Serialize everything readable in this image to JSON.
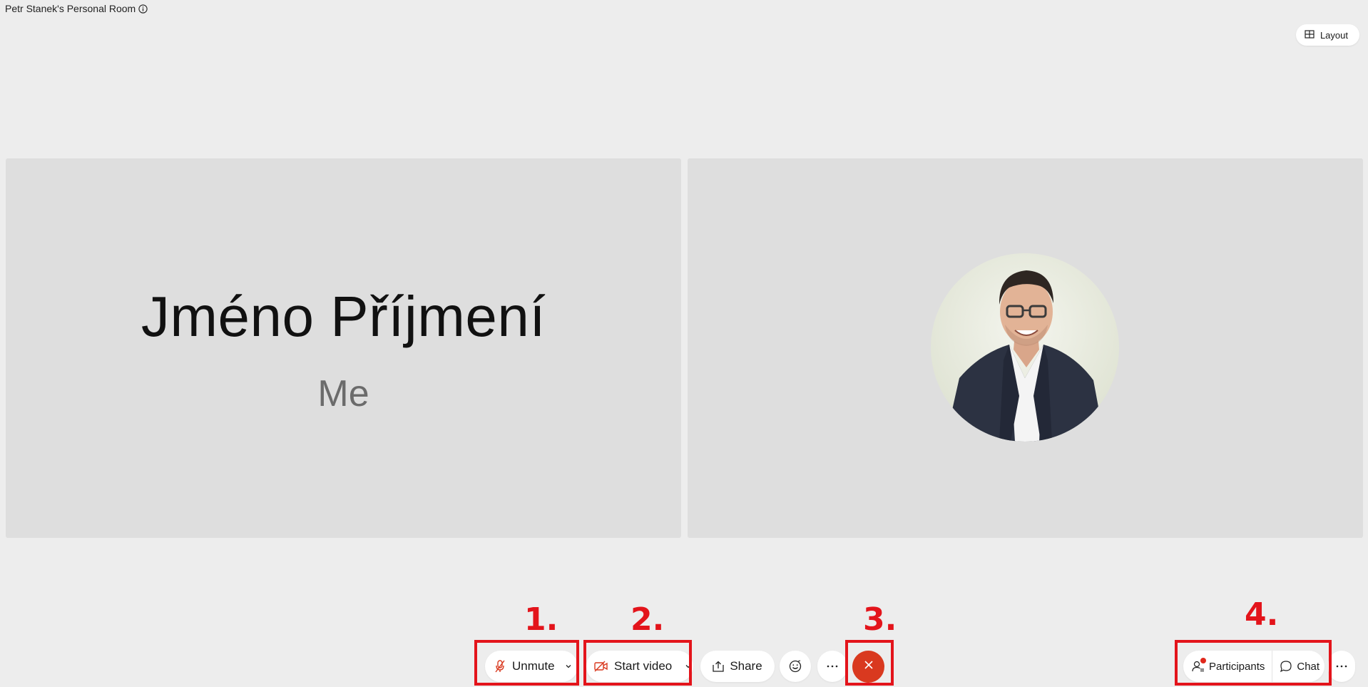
{
  "room": {
    "title": "Petr Stanek's Personal Room"
  },
  "layout": {
    "label": "Layout"
  },
  "tiles": {
    "self": {
      "name": "Jméno Příjmení",
      "subtitle": "Me"
    }
  },
  "toolbar": {
    "unmute_label": "Unmute",
    "start_video_label": "Start video",
    "share_label": "Share"
  },
  "side": {
    "participants_label": "Participants",
    "chat_label": "Chat"
  },
  "annotations": {
    "one": "1.",
    "two": "2.",
    "three": "3.",
    "four": "4."
  },
  "colors": {
    "annotation_red": "#e3141b",
    "end_call_red": "#d9391f",
    "background": "#ededed",
    "tile": "#dedede"
  }
}
